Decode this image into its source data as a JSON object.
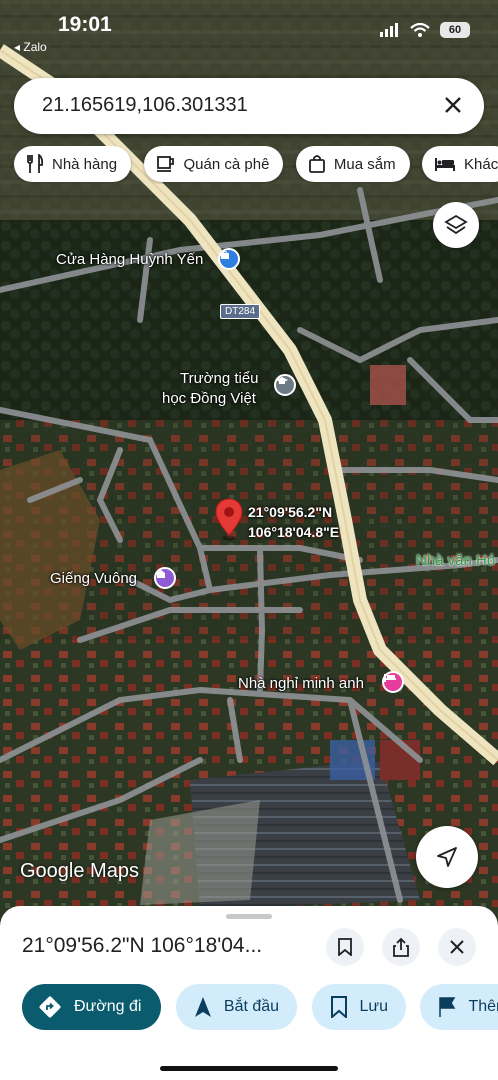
{
  "status_bar": {
    "time": "19:01",
    "back_app": "◂ Zalo",
    "battery": "60"
  },
  "search": {
    "value": "21.165619,106.301331"
  },
  "chips": [
    {
      "label": "Nhà hàng",
      "icon": "fork-knife-icon"
    },
    {
      "label": "Quán cà phê",
      "icon": "coffee-icon"
    },
    {
      "label": "Mua sắm",
      "icon": "shopping-bag-icon"
    },
    {
      "label": "Khác",
      "icon": "bed-icon"
    }
  ],
  "map": {
    "labels": {
      "shop": "Cửa Hàng Huỳnh Yến",
      "school_1": "Trường tiểu",
      "school_2": "học Đồng Việt",
      "well": "Giếng Vuông",
      "community": "Nhà văn Hó",
      "guesthouse": "Nhà nghỉ minh anh",
      "road": "DT284"
    },
    "pin": {
      "lat_label": "21°09'56.2\"N",
      "lon_label": "106°18'04.8\"E"
    },
    "watermark": "Google Maps",
    "colors": {
      "pin": "#e53935",
      "road": "#efe4c0",
      "shop_poi": "#2f7fe0",
      "school_poi": "#6b7a85",
      "well_poi": "#8e5ad6",
      "hotel_poi": "#e43d9b"
    }
  },
  "sheet": {
    "title": "21°09'56.2\"N 106°18'04...",
    "actions": [
      {
        "label": "Đường đi",
        "icon": "directions-icon"
      },
      {
        "label": "Bắt đầu",
        "icon": "navigation-arrow-icon"
      },
      {
        "label": "Lưu",
        "icon": "bookmark-icon"
      },
      {
        "label": "Thêm",
        "icon": "flag-icon"
      }
    ]
  }
}
